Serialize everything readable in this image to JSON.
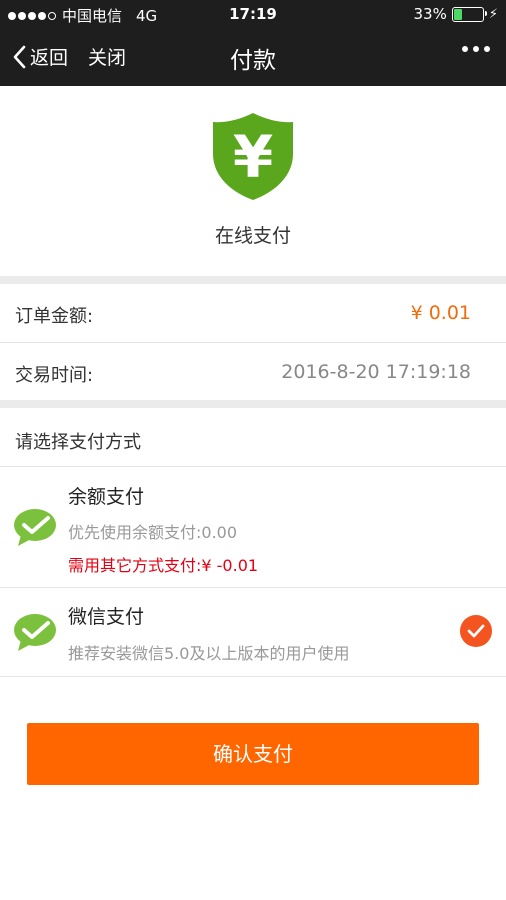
{
  "status_bar": {
    "carrier": "中国电信",
    "network": "4G",
    "time": "17:19",
    "battery_percent": "33%",
    "battery_level": 0.33
  },
  "nav": {
    "back_label": "返回",
    "close_label": "关闭",
    "title": "付款"
  },
  "header": {
    "label": "在线支付",
    "currency_symbol": "¥"
  },
  "order": {
    "amount_label": "订单金额:",
    "amount_value": "¥ 0.01",
    "time_label": "交易时间:",
    "time_value": "2016-8-20 17:19:18"
  },
  "payment": {
    "section_title": "请选择支付方式",
    "methods": [
      {
        "name": "余额支付",
        "desc": "优先使用余额支付:0.00",
        "warning": "需用其它方式支付:¥ -0.01",
        "selected": false
      },
      {
        "name": "微信支付",
        "desc": "推荐安装微信5.0及以上版本的用户使用",
        "selected": true
      }
    ]
  },
  "confirm_label": "确认支付",
  "colors": {
    "accent": "#ff6600",
    "amount": "#f26c0c",
    "warning": "#e60012",
    "shield": "#5aa61d",
    "wechat": "#7bc13e",
    "check": "#f4541f"
  }
}
